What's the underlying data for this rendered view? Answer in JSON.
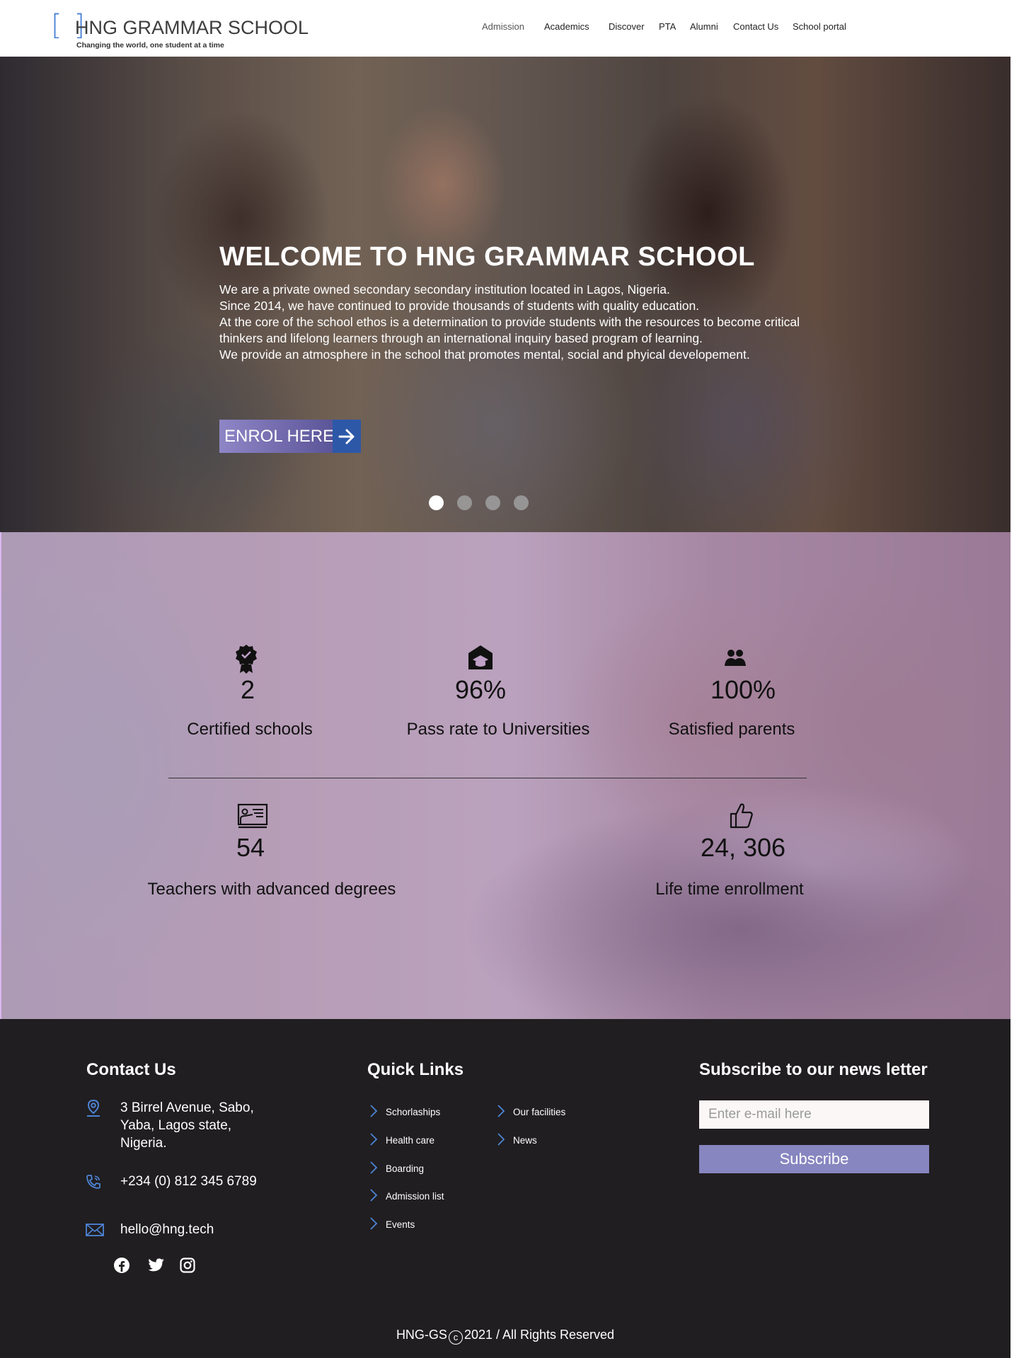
{
  "brand": {
    "brackets": "[ ]",
    "name": "HNG GRAMMAR SCHOOL",
    "tagline": "Changing the world, one student at a time",
    "accent_color": "#4d84d6"
  },
  "nav": {
    "items": [
      {
        "label": "Admission"
      },
      {
        "label": "Academics"
      },
      {
        "label": "Discover"
      },
      {
        "label": "PTA"
      },
      {
        "label": "Alumni"
      },
      {
        "label": "Contact Us"
      },
      {
        "label": "School portal"
      }
    ]
  },
  "hero": {
    "title": "WELCOME TO HNG GRAMMAR SCHOOL",
    "paragraphs": [
      "We are a private owned secondary secondary institution located in Lagos, Nigeria.",
      "Since 2014, we have continued to provide thousands of students with quality education.",
      "At the core of the school ethos is a determination to provide students with the resources to become critical thinkers and lifelong learners through an international inquiry based program of learning.",
      "We provide an atmosphere in the school that promotes mental, social and phyical developement."
    ],
    "cta_label": "ENROL HERE",
    "cta_icon": "arrow-right-icon",
    "slides_count": 4,
    "active_slide": 1
  },
  "stats": [
    {
      "icon": "award-badge-icon",
      "value": "2",
      "label": "Certified schools"
    },
    {
      "icon": "graduation-school-icon",
      "value": "96%",
      "label": "Pass rate to Universities"
    },
    {
      "icon": "parents-icon",
      "value": "100%",
      "label": "Satisfied parents"
    },
    {
      "icon": "teacher-board-icon",
      "value": "54",
      "label": "Teachers with advanced degrees"
    },
    {
      "icon": "thumbs-up-icon",
      "value": "24, 306",
      "label": "Life time enrollment"
    }
  ],
  "footer": {
    "contact": {
      "heading": "Contact Us",
      "address_lines": [
        "3 Birrel Avenue, Sabo,",
        "Yaba, Lagos state,",
        "Nigeria."
      ],
      "phone": "+234 (0) 812 345 6789",
      "email": "hello@hng.tech"
    },
    "quick_links": {
      "heading": "Quick Links",
      "items": [
        "Schorlaships",
        "Health care",
        "Boarding",
        "Admission list",
        "Events",
        "Our facilities",
        "News"
      ]
    },
    "newsletter": {
      "heading": "Subscribe to our news letter",
      "placeholder": "Enter e-mail here",
      "button_label": "Subscribe"
    },
    "social": [
      "facebook-icon",
      "twitter-icon",
      "instagram-icon"
    ],
    "copyright_prefix": "HNG-GS",
    "copyright_symbol": "c",
    "copyright_suffix": "2021 / All Rights Reserved"
  },
  "colors": {
    "icon_blue": "#4d84d6",
    "footer_bg": "#201e20",
    "subscribe_bg": "#8786c0",
    "stats_overlay": "#b696c0"
  }
}
